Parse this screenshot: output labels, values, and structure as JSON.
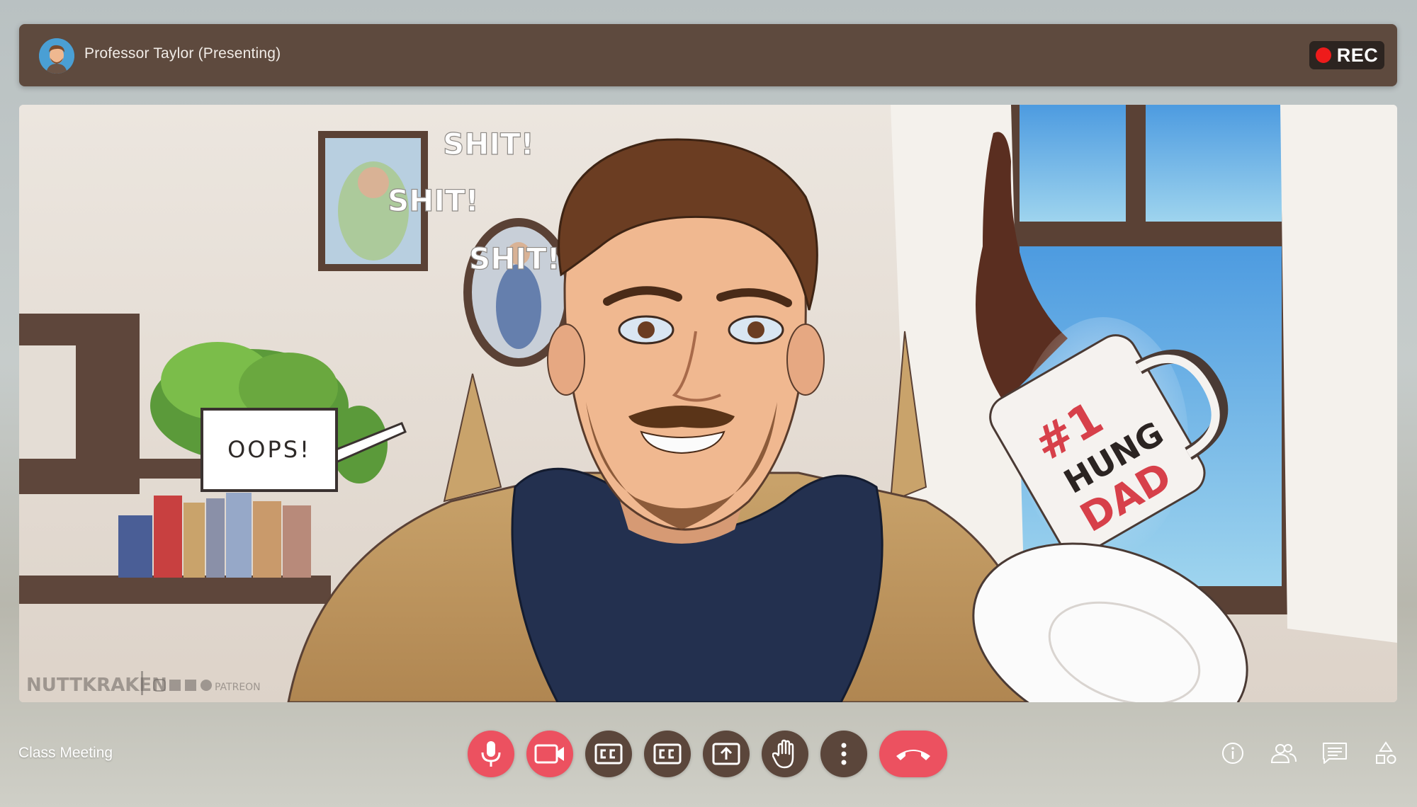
{
  "header": {
    "presenter_label": "Professor Taylor (Presenting)",
    "avatar_icon": "presenter-avatar",
    "recording_label": "REC",
    "recording_color": "#ee1b1b"
  },
  "video": {
    "captions": [
      "SHIT!",
      "SHIT!",
      "SHIT!"
    ],
    "speech_bubble": "OOPS!",
    "mug_text": {
      "line1": "#1",
      "line2": "HUNG",
      "line3": "DAD"
    },
    "watermark": {
      "artist": "NUTTKRAKEN",
      "platform": "PATREON"
    }
  },
  "footer": {
    "meeting_name": "Class Meeting",
    "controls": [
      {
        "name": "microphone-button",
        "icon": "microphone-icon",
        "active_color": "#ec5160"
      },
      {
        "name": "camera-button",
        "icon": "video-camera-icon",
        "active_color": "#ec5160"
      },
      {
        "name": "captions-button",
        "icon": "closed-captions-icon"
      },
      {
        "name": "captions-alt-button",
        "icon": "closed-captions-icon"
      },
      {
        "name": "share-screen-button",
        "icon": "share-screen-icon"
      },
      {
        "name": "raise-hand-button",
        "icon": "hand-icon"
      },
      {
        "name": "more-options-button",
        "icon": "vertical-dots-icon"
      },
      {
        "name": "end-call-button",
        "icon": "phone-hangup-icon",
        "color": "#ec5160"
      }
    ],
    "right_icons": [
      "info-icon",
      "people-icon",
      "chat-icon",
      "activities-icon"
    ]
  },
  "colors": {
    "header_bg": "#5e4a3e",
    "control_bg": "#5b463b",
    "accent_red": "#ec5160"
  }
}
